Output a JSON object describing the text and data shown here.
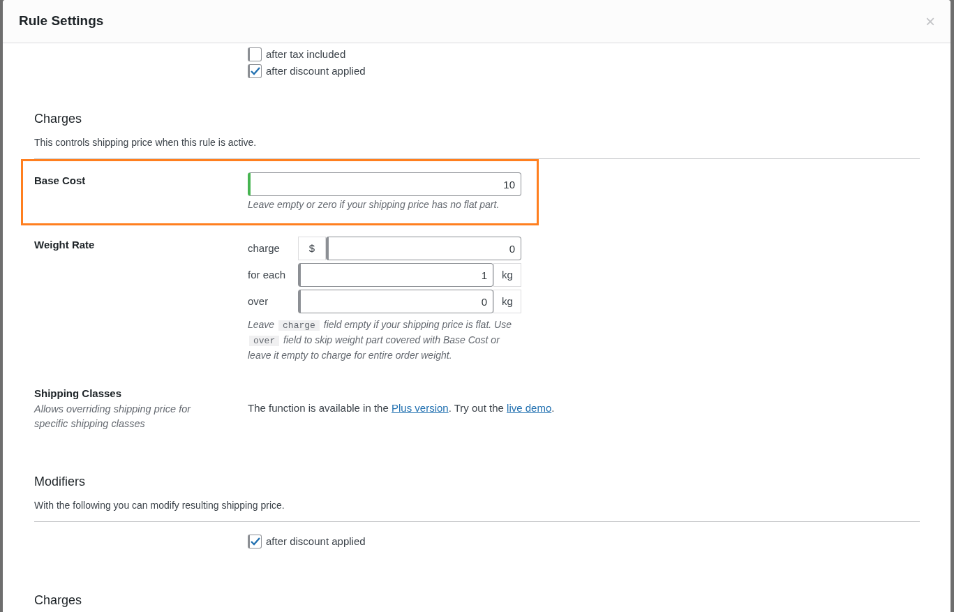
{
  "dialog": {
    "title": "Rule Settings",
    "close": "×"
  },
  "top_options": [
    {
      "label": "after tax included",
      "checked": false
    },
    {
      "label": "after discount applied",
      "checked": true
    }
  ],
  "sections": [
    {
      "title": "Charges",
      "description": "This controls shipping price when this rule is active.",
      "rows": [
        {
          "kind": "input",
          "label": "Base Cost",
          "highlighted": true,
          "focused": true,
          "value": "10",
          "hint": "Leave empty or zero if your shipping price has no flat part."
        },
        {
          "kind": "weight",
          "label": "Weight Rate",
          "highlighted": false,
          "lines": [
            {
              "label": "charge",
              "prefix": "$",
              "value": "0",
              "focused": false
            },
            {
              "label": "for each",
              "value": "1",
              "suffix": "kg",
              "focused": false
            },
            {
              "label": "over",
              "value": "0",
              "suffix": "kg",
              "focused": false
            }
          ],
          "hint": [
            {
              "kind": "text",
              "text": "Leave "
            },
            {
              "kind": "code",
              "text": "charge"
            },
            {
              "kind": "text",
              "text": " field empty if your shipping price is flat. Use "
            },
            {
              "kind": "code",
              "text": "over"
            },
            {
              "kind": "text",
              "text": " field to skip weight part covered with Base Cost or leave it empty to charge for entire order weight."
            }
          ]
        },
        {
          "kind": "notice",
          "label": "Shipping Classes",
          "highlighted": false,
          "sublabel": "Allows overriding shipping price for specific shipping classes",
          "segments": [
            {
              "kind": "text",
              "text": "The function is available in the "
            },
            {
              "kind": "link",
              "text": "Plus version"
            },
            {
              "kind": "text",
              "text": ". Try out the "
            },
            {
              "kind": "link",
              "text": "live demo"
            },
            {
              "kind": "text",
              "text": "."
            }
          ]
        }
      ]
    },
    {
      "title": "Modifiers",
      "description": "With the following you can modify resulting shipping price.",
      "rows": [
        {
          "kind": "checkbox",
          "highlighted": false,
          "label": "after discount applied",
          "checked": true
        }
      ]
    },
    {
      "title": "Charges"
    }
  ]
}
